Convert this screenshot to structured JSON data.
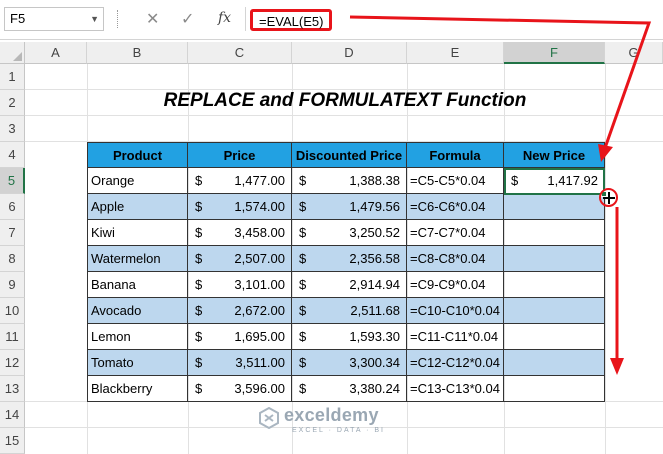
{
  "formula_bar": {
    "name_box": "F5",
    "cancel_icon": "✕",
    "enter_icon": "✓",
    "fx_label": "fx",
    "formula": "=EVAL(E5)"
  },
  "columns": [
    "A",
    "B",
    "C",
    "D",
    "E",
    "F",
    "G"
  ],
  "rows": [
    "1",
    "2",
    "3",
    "4",
    "5",
    "6",
    "7",
    "8",
    "9",
    "10",
    "11",
    "12",
    "13",
    "14",
    "15"
  ],
  "selected_cell": "F5",
  "title": "REPLACE and FORMULATEXT Function",
  "table": {
    "headers": [
      "Product",
      "Price",
      "Discounted Price",
      "Formula",
      "New Price"
    ],
    "currency_symbol": "$",
    "rows": [
      {
        "product": "Orange",
        "price": "1,477.00",
        "discounted": "1,388.38",
        "formula": "=C5-C5*0.04",
        "new_price": "1,417.92"
      },
      {
        "product": "Apple",
        "price": "1,574.00",
        "discounted": "1,479.56",
        "formula": "=C6-C6*0.04",
        "new_price": ""
      },
      {
        "product": "Kiwi",
        "price": "3,458.00",
        "discounted": "3,250.52",
        "formula": "=C7-C7*0.04",
        "new_price": ""
      },
      {
        "product": "Watermelon",
        "price": "2,507.00",
        "discounted": "2,356.58",
        "formula": "=C8-C8*0.04",
        "new_price": ""
      },
      {
        "product": "Banana",
        "price": "3,101.00",
        "discounted": "2,914.94",
        "formula": "=C9-C9*0.04",
        "new_price": ""
      },
      {
        "product": "Avocado",
        "price": "2,672.00",
        "discounted": "2,511.68",
        "formula": "=C10-C10*0.04",
        "new_price": ""
      },
      {
        "product": "Lemon",
        "price": "1,695.00",
        "discounted": "1,593.30",
        "formula": "=C11-C11*0.04",
        "new_price": ""
      },
      {
        "product": "Tomato",
        "price": "3,511.00",
        "discounted": "3,300.34",
        "formula": "=C12-C12*0.04",
        "new_price": ""
      },
      {
        "product": "Blackberry",
        "price": "3,596.00",
        "discounted": "3,380.24",
        "formula": "=C13-C13*0.04",
        "new_price": ""
      }
    ]
  },
  "watermark": {
    "name": "exceldemy",
    "tagline": "EXCEL · DATA · BI"
  },
  "colors": {
    "header_fill": "#22a1e2",
    "band_fill": "#bdd7ee",
    "annotation_red": "#e8141a",
    "selection_green": "#217346"
  }
}
